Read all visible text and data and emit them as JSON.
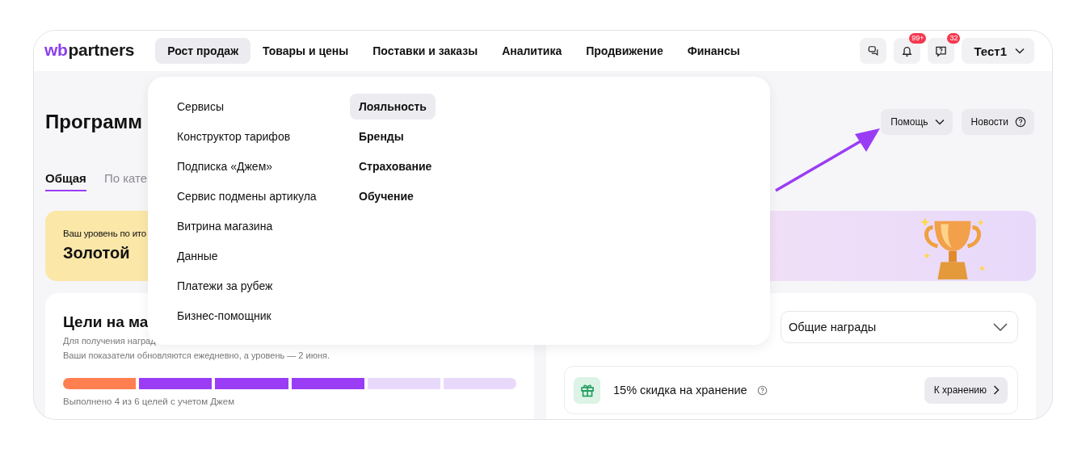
{
  "logo": {
    "mark": "wb",
    "name": "partners"
  },
  "nav": [
    {
      "label": "Рост продаж",
      "selected": true
    },
    {
      "label": "Товары и цены",
      "selected": false
    },
    {
      "label": "Поставки и заказы",
      "selected": false
    },
    {
      "label": "Аналитика",
      "selected": false
    },
    {
      "label": "Продвижение",
      "selected": false
    },
    {
      "label": "Финансы",
      "selected": false
    }
  ],
  "header_actions": [
    {
      "kind": "chat"
    },
    {
      "kind": "bell",
      "badge": "99+"
    },
    {
      "kind": "support",
      "badge": "32"
    }
  ],
  "user": {
    "label": "Тест1"
  },
  "dropdown": {
    "columns": [
      {
        "items": [
          {
            "label": "Сервисы",
            "selected": false
          },
          {
            "label": "Конструктор тарифов",
            "selected": false
          },
          {
            "label": "Подписка «Джем»",
            "selected": false
          },
          {
            "label": "Сервис подмены артикула",
            "selected": false
          },
          {
            "label": "Витрина магазина",
            "selected": false
          },
          {
            "label": "Данные",
            "selected": false
          },
          {
            "label": "Платежи за рубеж",
            "selected": false
          },
          {
            "label": "Бизнес-помощник",
            "selected": false
          }
        ]
      },
      {
        "items": [
          {
            "label": "Лояльность",
            "selected": true
          },
          {
            "label": "Бренды",
            "selected": false
          },
          {
            "label": "Страхование",
            "selected": false
          },
          {
            "label": "Обучение",
            "selected": false
          }
        ]
      }
    ]
  },
  "page": {
    "title": "Программ",
    "help_button": "Помощь",
    "news_button": "Новости"
  },
  "tabs": [
    {
      "label": "Общая",
      "selected": true
    },
    {
      "label": "По кате",
      "selected": false
    }
  ],
  "level_card": {
    "caption": "Ваш уровень по ито",
    "level": "Золотой"
  },
  "goals": {
    "title": "Цели на ма",
    "lines": [
      "Для получения наград",
      "Ваши показатели обновляются ежедневно, а уровень — 2 июня."
    ],
    "segments": [
      {
        "color": "#ff7f50"
      },
      {
        "color": "#9b3cf5"
      },
      {
        "color": "#9b3cf5"
      },
      {
        "color": "#9b3cf5"
      },
      {
        "color": "#e8d9fb"
      },
      {
        "color": "#e8d9fb"
      }
    ],
    "summary": "Выполнено 4 из 6 целей с учетом Джем"
  },
  "rewards": {
    "select": "Общие награды",
    "items": [
      {
        "title": "15% скидка на хранение",
        "action": "К хранению"
      }
    ]
  }
}
